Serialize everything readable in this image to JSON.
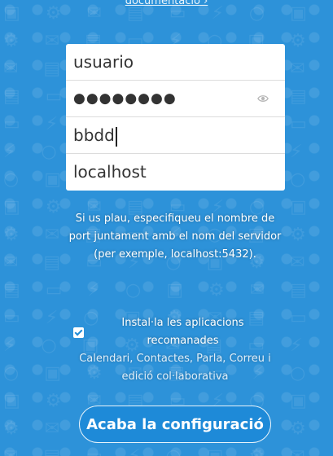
{
  "header": {
    "link_text": "documentació ›"
  },
  "form": {
    "username": {
      "value": "usuario"
    },
    "password": {
      "value": "●●●●●●●●"
    },
    "database": {
      "value": "bbdd"
    },
    "host": {
      "value": "localhost"
    }
  },
  "hint": {
    "text": "Si us plau, especifiqueu el nombre de port juntament amb el nom del servidor (per exemple, localhost:5432)."
  },
  "apps": {
    "checkbox_label": "Instal·la les aplicacions recomanades",
    "list": "Calendari, Contactes, Parla, Correu i edició col·laborativa",
    "checked": true
  },
  "finish_button": {
    "label": "Acaba la configuració"
  },
  "colors": {
    "background": "#1d8ad6",
    "text": "#ffffff"
  },
  "icons": {
    "password_toggle": "eye-icon",
    "checkbox": "checkmark-icon"
  }
}
